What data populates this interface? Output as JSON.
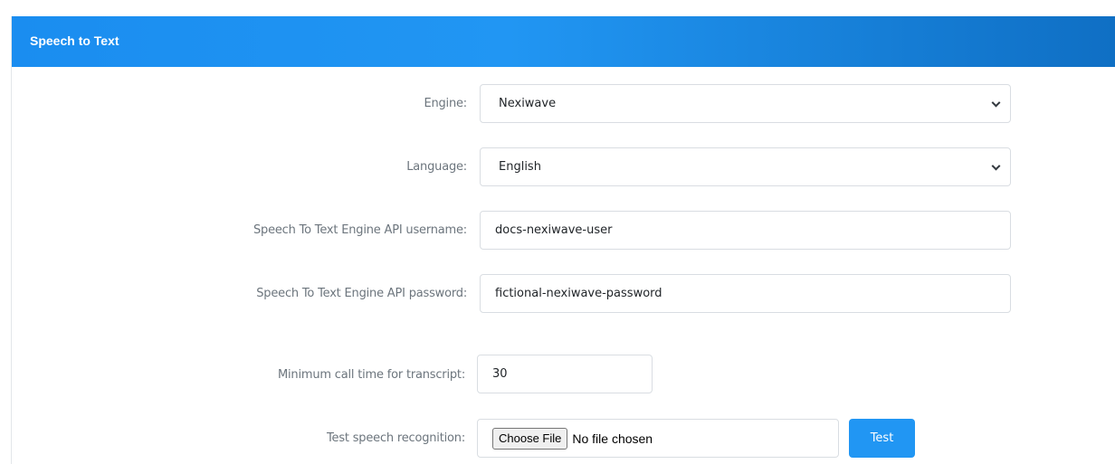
{
  "panel": {
    "title": "Speech to Text"
  },
  "engine": {
    "label": "Engine:",
    "value": "Nexiwave"
  },
  "language": {
    "label": "Language:",
    "value": "English"
  },
  "api_username": {
    "label": "Speech To Text Engine API username:",
    "value": "docs-nexiwave-user"
  },
  "api_password": {
    "label": "Speech To Text Engine API password:",
    "value": "fictional-nexiwave-password"
  },
  "min_call_time": {
    "label": "Minimum call time for transcript:",
    "value": "30"
  },
  "test_recognition": {
    "label": "Test speech recognition:",
    "choose_file_label": "Choose File",
    "file_status": "No file chosen",
    "test_button_label": "Test"
  },
  "colors": {
    "header": "#2196f3",
    "test_button": "#2196f3"
  }
}
